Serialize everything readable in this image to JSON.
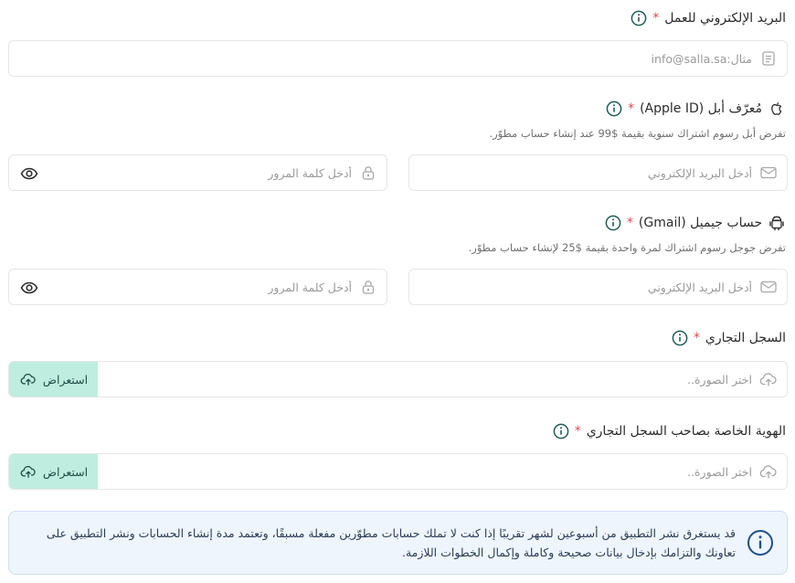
{
  "work_email": {
    "label": "البريد الإلكتروني للعمل",
    "required_mark": "*",
    "placeholder": "مثال:info@salla.sa"
  },
  "apple_id": {
    "label": "مُعرّف أبل (Apple ID)",
    "required_mark": "*",
    "hint": "تفرض أبل رسوم اشتراك سنوية بقيمة $99 عند إنشاء حساب مطوّر.",
    "email_placeholder": "أدخل البريد الإلكتروني",
    "password_placeholder": "أدخل كلمة المرور"
  },
  "gmail": {
    "label": "حساب جيميل (Gmail)",
    "required_mark": "*",
    "hint": "تفرض جوجل رسوم اشتراك لمرة واحدة بقيمة $25 لإنشاء حساب مطوّر.",
    "email_placeholder": "أدخل البريد الإلكتروني",
    "password_placeholder": "أدخل كلمة المرور"
  },
  "commercial_register": {
    "label": "السجل التجاري",
    "required_mark": "*",
    "placeholder": "اختر الصورة..",
    "browse_label": "استعراض"
  },
  "owner_id": {
    "label": "الهوية الخاصة بصاحب السجل التجاري",
    "required_mark": "*",
    "placeholder": "اختر الصورة..",
    "browse_label": "استعراض"
  },
  "notice": {
    "text": "قد يستغرق نشر التطبيق من أسبوعين لشهر تقريبًا إذا كنت لا تملك حسابات مطوّرين مفعلة مسبقًا، وتعتمد مدة إنشاء الحسابات ونشر التطبيق على تعاونك والتزامك بإدخال بيانات صحيحة وكاملة وإكمال الخطوات اللازمة."
  },
  "icons": {
    "info": "info-circle-icon",
    "document": "document-icon",
    "apple": "apple-icon",
    "android": "android-icon",
    "mail": "mail-icon",
    "lock": "lock-icon",
    "eye": "eye-icon",
    "upload": "cloud-upload-icon"
  },
  "colors": {
    "required": "#e5484d",
    "info_icon": "#1f5c55",
    "browse_bg": "#bfeee0",
    "notice_bg": "#eef5fd",
    "notice_icon": "#1e4f8c"
  }
}
